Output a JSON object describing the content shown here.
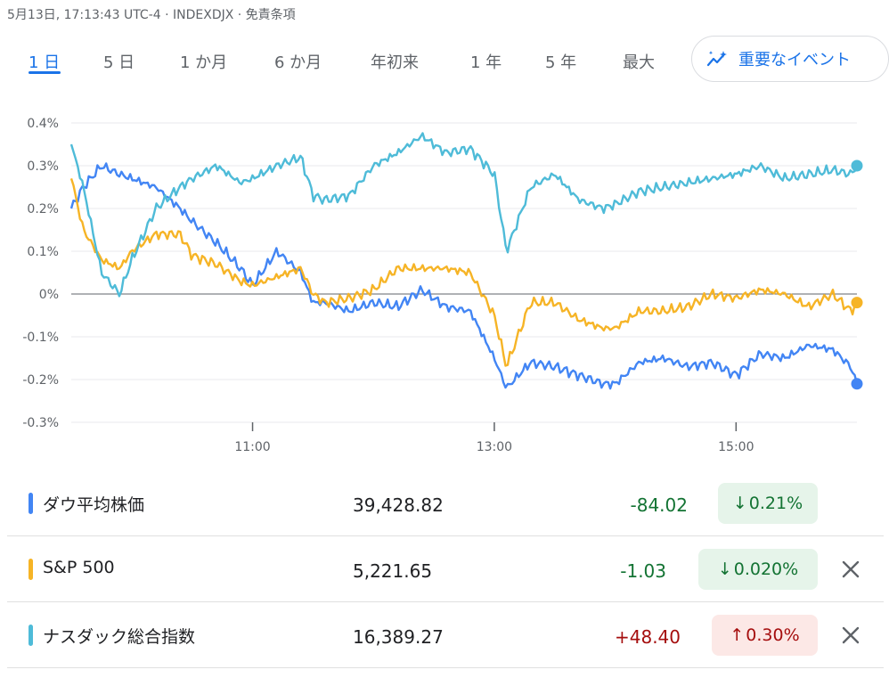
{
  "header": {
    "text": "5月13日, 17:13:43 UTC-4 · INDEXDJX · 免責条項"
  },
  "tabs": [
    {
      "label": "1 日",
      "active": true
    },
    {
      "label": "5 日",
      "active": false
    },
    {
      "label": "1 か月",
      "active": false
    },
    {
      "label": "6 か月",
      "active": false
    },
    {
      "label": "年初来",
      "active": false
    },
    {
      "label": "1 年",
      "active": false
    },
    {
      "label": "5 年",
      "active": false
    },
    {
      "label": "最大",
      "active": false
    }
  ],
  "key_events_button": {
    "label": "重要なイベント",
    "icon": "sparkle-chart-icon"
  },
  "chart_data": {
    "type": "line",
    "ylim": [
      -0.3,
      0.4
    ],
    "yticks": [
      "0.4%",
      "0.3%",
      "0.2%",
      "0.1%",
      "0%",
      "-0.1%",
      "-0.2%",
      "-0.3%"
    ],
    "xticks": [
      "11:00",
      "13:00",
      "15:00"
    ],
    "x_unit": "hour",
    "x_range": [
      9.5,
      16.0
    ],
    "xtick_values": [
      11,
      13,
      15
    ],
    "grid": true,
    "series": [
      {
        "name": "ダウ平均株価",
        "color": "#4285f4",
        "x": [
          9.5,
          9.6,
          9.75,
          9.9,
          10.0,
          10.2,
          10.4,
          10.5,
          10.7,
          10.9,
          11.0,
          11.2,
          11.4,
          11.5,
          11.6,
          11.8,
          12.0,
          12.2,
          12.4,
          12.6,
          12.8,
          13.0,
          13.1,
          13.3,
          13.5,
          13.7,
          13.9,
          14.0,
          14.2,
          14.4,
          14.6,
          14.8,
          15.0,
          15.2,
          15.4,
          15.6,
          15.8,
          15.95,
          16.0
        ],
        "values": [
          0.2,
          0.25,
          0.3,
          0.28,
          0.27,
          0.25,
          0.2,
          0.17,
          0.12,
          0.06,
          0.02,
          0.1,
          0.05,
          -0.02,
          -0.02,
          -0.04,
          -0.02,
          -0.03,
          0.01,
          -0.03,
          -0.04,
          -0.15,
          -0.22,
          -0.16,
          -0.17,
          -0.19,
          -0.21,
          -0.21,
          -0.16,
          -0.15,
          -0.17,
          -0.16,
          -0.19,
          -0.14,
          -0.15,
          -0.12,
          -0.13,
          -0.17,
          -0.21
        ]
      },
      {
        "name": "S&P 500",
        "color": "#f6b426",
        "x": [
          9.5,
          9.6,
          9.75,
          9.9,
          10.0,
          10.2,
          10.4,
          10.5,
          10.7,
          10.9,
          11.0,
          11.2,
          11.4,
          11.5,
          11.6,
          11.8,
          12.0,
          12.2,
          12.4,
          12.6,
          12.8,
          13.0,
          13.1,
          13.3,
          13.5,
          13.7,
          13.9,
          14.0,
          14.2,
          14.4,
          14.6,
          14.8,
          15.0,
          15.2,
          15.4,
          15.6,
          15.8,
          15.95,
          16.0
        ],
        "values": [
          0.27,
          0.15,
          0.08,
          0.06,
          0.1,
          0.14,
          0.14,
          0.09,
          0.07,
          0.03,
          0.02,
          0.04,
          0.06,
          0.0,
          -0.02,
          -0.01,
          0.01,
          0.06,
          0.06,
          0.06,
          0.05,
          -0.05,
          -0.17,
          -0.02,
          -0.02,
          -0.06,
          -0.08,
          -0.08,
          -0.04,
          -0.04,
          -0.03,
          0.0,
          -0.01,
          0.01,
          0.0,
          -0.03,
          0.0,
          -0.04,
          -0.02
        ]
      },
      {
        "name": "ナスダック総合指数",
        "color": "#4ebbd8",
        "x": [
          9.5,
          9.6,
          9.75,
          9.9,
          10.0,
          10.2,
          10.4,
          10.5,
          10.7,
          10.9,
          11.0,
          11.2,
          11.4,
          11.5,
          11.6,
          11.8,
          12.0,
          12.2,
          12.4,
          12.6,
          12.8,
          13.0,
          13.1,
          13.3,
          13.5,
          13.7,
          13.9,
          14.0,
          14.2,
          14.4,
          14.6,
          14.8,
          15.0,
          15.2,
          15.4,
          15.6,
          15.8,
          15.95,
          16.0
        ],
        "values": [
          0.35,
          0.25,
          0.05,
          0.0,
          0.08,
          0.2,
          0.25,
          0.27,
          0.3,
          0.26,
          0.27,
          0.3,
          0.32,
          0.23,
          0.22,
          0.23,
          0.3,
          0.33,
          0.37,
          0.33,
          0.34,
          0.28,
          0.1,
          0.25,
          0.28,
          0.22,
          0.2,
          0.21,
          0.24,
          0.25,
          0.26,
          0.27,
          0.28,
          0.3,
          0.27,
          0.28,
          0.29,
          0.28,
          0.3
        ]
      }
    ]
  },
  "rows": [
    {
      "name": "ダウ平均株価",
      "price": "39,428.82",
      "change": "-84.02",
      "pct": "0.21%",
      "dir": "down",
      "arrow": "↓",
      "color": "#4285f4",
      "closable": false
    },
    {
      "name": "S&P 500",
      "price": "5,221.65",
      "change": "-1.03",
      "pct": "0.020%",
      "dir": "down",
      "arrow": "↓",
      "color": "#f6b426",
      "closable": true
    },
    {
      "name": "ナスダック総合指数",
      "price": "16,389.27",
      "change": "+48.40",
      "pct": "0.30%",
      "dir": "up",
      "arrow": "↑",
      "color": "#4ebbd8",
      "closable": true
    }
  ]
}
